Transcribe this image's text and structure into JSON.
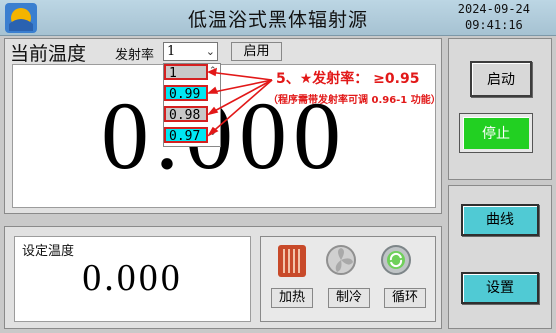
{
  "header": {
    "title": "低温浴式黑体辐射源",
    "date": "2024-09-24",
    "time": "09:41:16"
  },
  "main": {
    "current_temp_label": "当前温度",
    "emissivity_label": "发射率",
    "emissivity_selected": "1",
    "enable_button": "启用",
    "current_value": "0.000",
    "emissivity_options": [
      "1",
      "0.99",
      "0.98",
      "0.97"
    ]
  },
  "annotation": {
    "line1": "5、★发射率：  ≥0.95",
    "line2": "（程序需带发射率可调 0.96-1 功能）",
    "color": "#e21818"
  },
  "bottom": {
    "set_temp_label": "设定温度",
    "set_value": "0.000",
    "heat_label": "加热",
    "cool_label": "制冷",
    "circulate_label": "循环"
  },
  "controls": {
    "start_label": "启动",
    "stop_label": "停止",
    "curve_label": "曲线",
    "setup_label": "设置"
  },
  "colors": {
    "accent_cyan": "#50cad4",
    "stop_green": "#22d022"
  }
}
